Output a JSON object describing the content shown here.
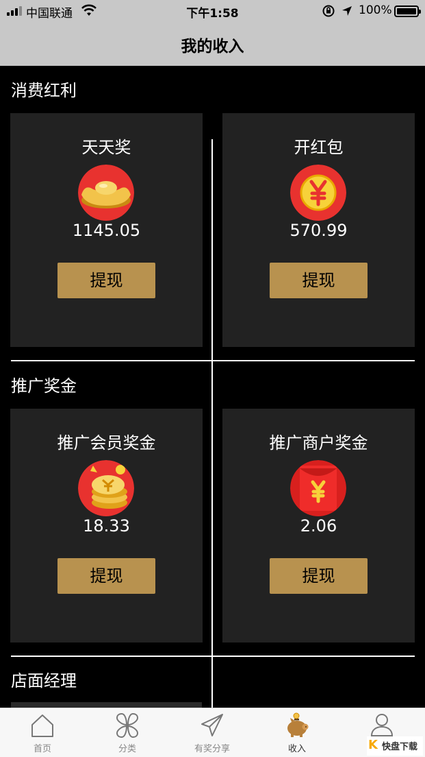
{
  "status_bar": {
    "carrier": "中国联通",
    "time": "下午1:58",
    "battery": "100%"
  },
  "nav": {
    "title": "我的收入"
  },
  "sections": [
    {
      "title": "消费红利",
      "cards": [
        {
          "title": "天天奖",
          "amount": "1145.05",
          "button": "提现",
          "icon": "gold-ingot-icon"
        },
        {
          "title": "开红包",
          "amount": "570.99",
          "button": "提现",
          "icon": "yuan-coin-icon"
        }
      ]
    },
    {
      "title": "推广奖金",
      "cards": [
        {
          "title": "推广会员奖金",
          "amount": "18.33",
          "button": "提现",
          "icon": "coin-stack-icon"
        },
        {
          "title": "推广商户奖金",
          "amount": "2.06",
          "button": "提现",
          "icon": "red-envelope-icon"
        }
      ]
    },
    {
      "title": "店面经理",
      "cards": []
    }
  ],
  "tabbar": {
    "items": [
      {
        "label": "首页",
        "icon": "home-icon"
      },
      {
        "label": "分类",
        "icon": "category-icon"
      },
      {
        "label": "有奖分享",
        "icon": "share-plane-icon"
      },
      {
        "label": "收入",
        "icon": "piggy-bank-icon",
        "active": true
      },
      {
        "label": "我的",
        "icon": "profile-icon"
      }
    ]
  },
  "watermark": {
    "text": "K快盘下载"
  },
  "colors": {
    "accent_gold": "#b8924f",
    "card_bg": "#222222",
    "red": "#e8322f"
  }
}
